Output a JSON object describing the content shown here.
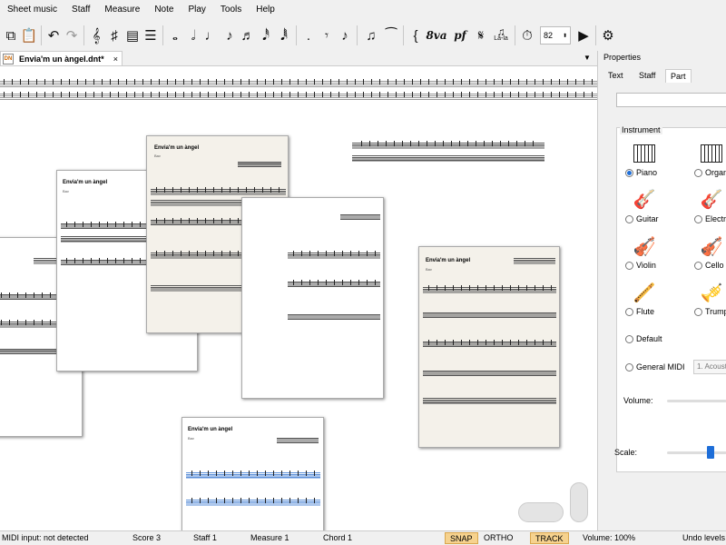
{
  "menu": [
    "Sheet music",
    "Staff",
    "Measure",
    "Note",
    "Play",
    "Tools",
    "Help"
  ],
  "toolbar": {
    "tempo_value": "82",
    "ottava_label": "8va",
    "dynamics_label": "pf",
    "lyrics_label": "La-la"
  },
  "document": {
    "tab_title": "Envia'm un àngel.dnt*",
    "tab_close": "×",
    "app_icon_text": "DN"
  },
  "score": {
    "title": "Envia'm un àngel",
    "subtitle": "Bav"
  },
  "properties": {
    "title": "Properties",
    "tabs": [
      "Text",
      "Staff",
      "Part"
    ],
    "active_tab": "Part",
    "group_label": "Instrument",
    "instruments": [
      {
        "label": "Piano",
        "selected": true
      },
      {
        "label": "Organ",
        "selected": false
      },
      {
        "label": "Guitar",
        "selected": false
      },
      {
        "label": "Electric",
        "selected": false
      },
      {
        "label": "Violin",
        "selected": false
      },
      {
        "label": "Cello",
        "selected": false
      },
      {
        "label": "Flute",
        "selected": false
      },
      {
        "label": "Trumpet",
        "selected": false
      }
    ],
    "default_label": "Default",
    "general_midi_label": "General MIDI",
    "midi_select_value": "1. Acoust",
    "volume_label": "Volume:",
    "scale_label": "Scale:"
  },
  "status": {
    "midi_input": "MIDI input:  not detected",
    "score": "Score 3",
    "staff": "Staff 1",
    "measure": "Measure 1",
    "chord": "Chord 1",
    "snap": "SNAP",
    "ortho": "ORTHO",
    "track": "TRACK",
    "volume": "Volume:  100%",
    "undo": "Undo levels"
  },
  "colors": {
    "accent": "#1e6ed8",
    "toggle_on": "#f6d28e"
  }
}
